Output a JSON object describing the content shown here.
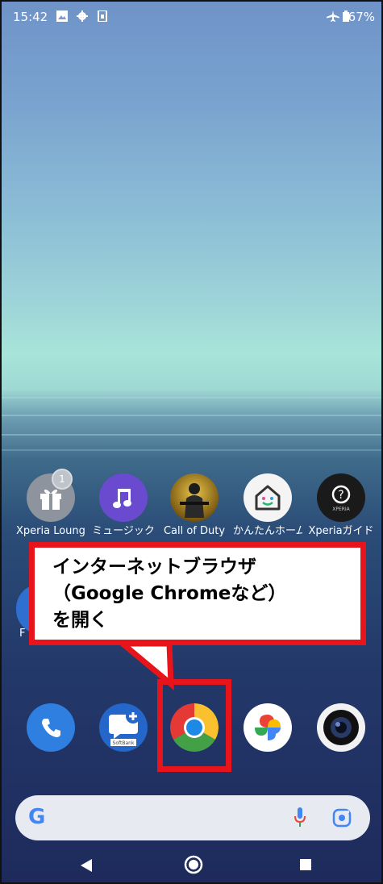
{
  "status_bar": {
    "time": "15:42",
    "icons": [
      "image-icon",
      "gear-icon",
      "sim-icon"
    ],
    "right_icons": [
      "airplane-icon",
      "battery-icon"
    ],
    "battery": "67%"
  },
  "apps_row1": [
    {
      "label": "Xperia Lounge",
      "badge": "1",
      "icon": "gift-icon"
    },
    {
      "label": "ミュージック",
      "icon": "music-note-icon"
    },
    {
      "label": "Call of Duty",
      "icon": "soldier-icon"
    },
    {
      "label": "かんたんホーム",
      "icon": "home-smile-icon"
    },
    {
      "label": "Xperiaガイド",
      "icon": "help-bubble-icon",
      "sub": "XPERIA"
    }
  ],
  "apps_row2_partial": {
    "label": "F"
  },
  "callout": {
    "line1": "インターネットブラウザ",
    "line2": "（Google Chromeなど）",
    "line3": "を開く"
  },
  "dock": [
    {
      "name": "phone-icon"
    },
    {
      "name": "message-icon",
      "sub": "SoftBank"
    },
    {
      "name": "chrome-icon"
    },
    {
      "name": "photos-icon"
    },
    {
      "name": "camera-icon"
    }
  ],
  "search": {
    "logo": "G"
  },
  "nav": {
    "back": "back-icon",
    "home": "home-icon",
    "recents": "recents-icon"
  },
  "colors": {
    "highlight": "#e8141b",
    "music": "#6a4bd0",
    "phone": "#2f7fe0"
  }
}
